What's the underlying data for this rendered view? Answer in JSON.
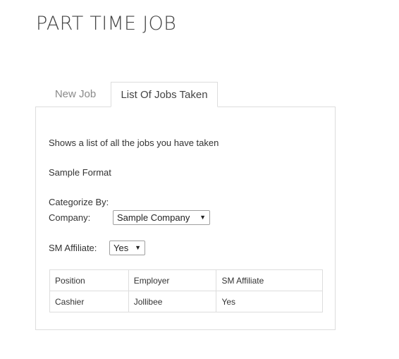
{
  "page": {
    "title": "PART TIME JOB"
  },
  "tabs": [
    {
      "label": "New Job",
      "active": false
    },
    {
      "label": "List Of Jobs Taken",
      "active": true
    }
  ],
  "panel": {
    "description": "Shows a list of all the jobs you have taken",
    "sample_format_label": "Sample Format",
    "categorize_label": "Categorize By:",
    "company_label": "Company:",
    "company_select": {
      "selected": "Sample Company"
    },
    "sm_affiliate_label": "SM Affiliate:",
    "sm_affiliate_select": {
      "selected": "Yes"
    },
    "table": {
      "headers": [
        "Position",
        "Employer",
        "SM Affiliate"
      ],
      "rows": [
        [
          "Cashier",
          "Jollibee",
          "Yes"
        ]
      ]
    }
  },
  "colors": {
    "border": "#dddddd",
    "inactive_tab_text": "#8a8a8a",
    "text": "#333333"
  },
  "icons": {
    "dropdown": "chevron-down-icon"
  }
}
